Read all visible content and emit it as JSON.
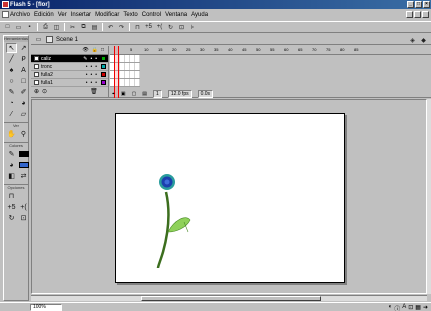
{
  "window": {
    "title": "Flash 5 - [flor]",
    "controls": [
      "_",
      "□",
      "×"
    ]
  },
  "menubar": {
    "items": [
      "Archivo",
      "Edición",
      "Ver",
      "Insertar",
      "Modificar",
      "Texto",
      "Control",
      "Ventana",
      "Ayuda"
    ]
  },
  "toolbar": {
    "icons": [
      "new-file-icon",
      "open-icon",
      "save-icon",
      "print-icon",
      "print-preview-icon",
      "cut-icon",
      "copy-icon",
      "paste-icon",
      "undo-icon",
      "redo-icon",
      "snap-icon",
      "smooth-icon",
      "straighten-icon",
      "rotate-icon",
      "scale-icon",
      "align-icon"
    ]
  },
  "toolbox": {
    "sections": {
      "tools": "Herramientas",
      "view": "Ver",
      "colors": "Colores",
      "options": "Opciones"
    },
    "stroke_color": "#000000",
    "fill_color": "#3366cc"
  },
  "scene": {
    "label": "Scene 1"
  },
  "timeline": {
    "layers": [
      {
        "name": "caliz",
        "color": "#00aa00",
        "active": true
      },
      {
        "name": "tronc",
        "color": "#00aaaa",
        "active": false
      },
      {
        "name": "fulla2",
        "color": "#cc0000",
        "active": false
      },
      {
        "name": "fulla1",
        "color": "#9900cc",
        "active": false
      }
    ],
    "ruler_numbers": [
      "5",
      "10",
      "15",
      "20",
      "25",
      "30",
      "35",
      "40",
      "45",
      "50",
      "55",
      "60",
      "65",
      "70",
      "75",
      "80",
      "85"
    ],
    "status": {
      "frame": "1",
      "fps": "12.0 fps",
      "time": "0.0s"
    }
  },
  "statusbar": {
    "zoom": "100%"
  }
}
